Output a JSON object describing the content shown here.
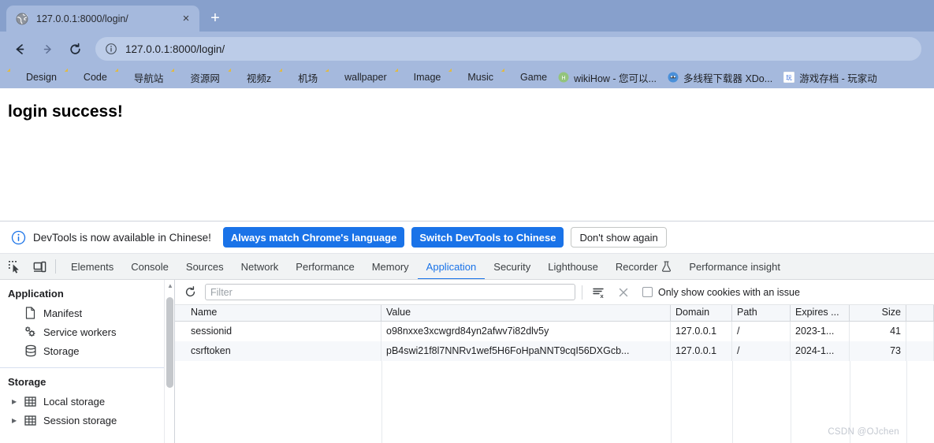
{
  "browser": {
    "tab": {
      "title": "127.0.0.1:8000/login/",
      "favicon": "globe-icon",
      "close": "×"
    },
    "newtab_label": "+",
    "nav": {
      "back": "←",
      "forward": "→",
      "reload": "↻"
    },
    "omnibox": {
      "url": "127.0.0.1:8000/login/",
      "security_icon": "info-circle-icon"
    },
    "bookmarks": [
      {
        "label": "Design",
        "icon": "folder-icon"
      },
      {
        "label": "Code",
        "icon": "folder-icon"
      },
      {
        "label": "导航站",
        "icon": "folder-icon"
      },
      {
        "label": "资源网",
        "icon": "folder-icon"
      },
      {
        "label": "视频z",
        "icon": "folder-icon"
      },
      {
        "label": "机场",
        "icon": "folder-icon"
      },
      {
        "label": "wallpaper",
        "icon": "folder-icon"
      },
      {
        "label": "Image",
        "icon": "folder-icon"
      },
      {
        "label": "Music",
        "icon": "folder-icon"
      },
      {
        "label": "Game",
        "icon": "folder-icon"
      },
      {
        "label": "wikiHow - 您可以...",
        "icon": "wikihow-icon"
      },
      {
        "label": "多线程下载器 XDo...",
        "icon": "xdown-icon"
      },
      {
        "label": "游戏存档 - 玩家动",
        "icon": "game-archive-icon"
      }
    ]
  },
  "page": {
    "heading": "login success!"
  },
  "devtools": {
    "banner": {
      "icon": "info-circle-icon",
      "message": "DevTools is now available in Chinese!",
      "primary_button": "Always match Chrome's language",
      "secondary_button": "Switch DevTools to Chinese",
      "dismiss_button": "Don't show again"
    },
    "tools": {
      "inspect": "inspect-element-icon",
      "device": "device-toolbar-icon"
    },
    "tabs": [
      {
        "label": "Elements",
        "active": false
      },
      {
        "label": "Console",
        "active": false
      },
      {
        "label": "Sources",
        "active": false
      },
      {
        "label": "Network",
        "active": false
      },
      {
        "label": "Performance",
        "active": false
      },
      {
        "label": "Memory",
        "active": false
      },
      {
        "label": "Application",
        "active": true
      },
      {
        "label": "Security",
        "active": false
      },
      {
        "label": "Lighthouse",
        "active": false
      },
      {
        "label": "Recorder",
        "active": false,
        "badge": "flask-icon"
      },
      {
        "label": "Performance insight",
        "active": false
      }
    ],
    "sidebar": {
      "groups": [
        {
          "title": "Application",
          "items": [
            {
              "label": "Manifest",
              "icon": "document-icon",
              "expandable": false
            },
            {
              "label": "Service workers",
              "icon": "gears-icon",
              "expandable": false
            },
            {
              "label": "Storage",
              "icon": "database-icon",
              "expandable": false
            }
          ]
        },
        {
          "title": "Storage",
          "items": [
            {
              "label": "Local storage",
              "icon": "table-icon",
              "expandable": true
            },
            {
              "label": "Session storage",
              "icon": "table-icon",
              "expandable": true
            }
          ]
        }
      ]
    },
    "cookies": {
      "toolbar": {
        "refresh_icon": "refresh-icon",
        "filter_placeholder": "Filter",
        "clear_filtered_icon": "clear-filtered-icon",
        "clear_all_icon": "close-x-icon",
        "issue_checkbox_label": "Only show cookies with an issue",
        "issue_checkbox_checked": false
      },
      "columns": [
        "Name",
        "Value",
        "Domain",
        "Path",
        "Expires ...",
        "Size",
        ""
      ],
      "rows": [
        {
          "name": "sessionid",
          "value": "o98nxxe3xcwgrd84yn2afwv7i82dlv5y",
          "domain": "127.0.0.1",
          "path": "/",
          "expires": "2023-1...",
          "size": "41",
          "extra": ""
        },
        {
          "name": "csrftoken",
          "value": "pB4swi21f8l7NNRv1wef5H6FoHpaNNT9cqI56DXGcb...",
          "domain": "127.0.0.1",
          "path": "/",
          "expires": "2024-1...",
          "size": "73",
          "extra": ""
        }
      ]
    }
  },
  "watermark": "CSDN @OJchen",
  "colors": {
    "chrome_frame": "#a5b9dd",
    "chrome_tabstrip": "#87a0cc",
    "accent_blue": "#1a73e8",
    "bookmark_folder": "#ffd966"
  }
}
